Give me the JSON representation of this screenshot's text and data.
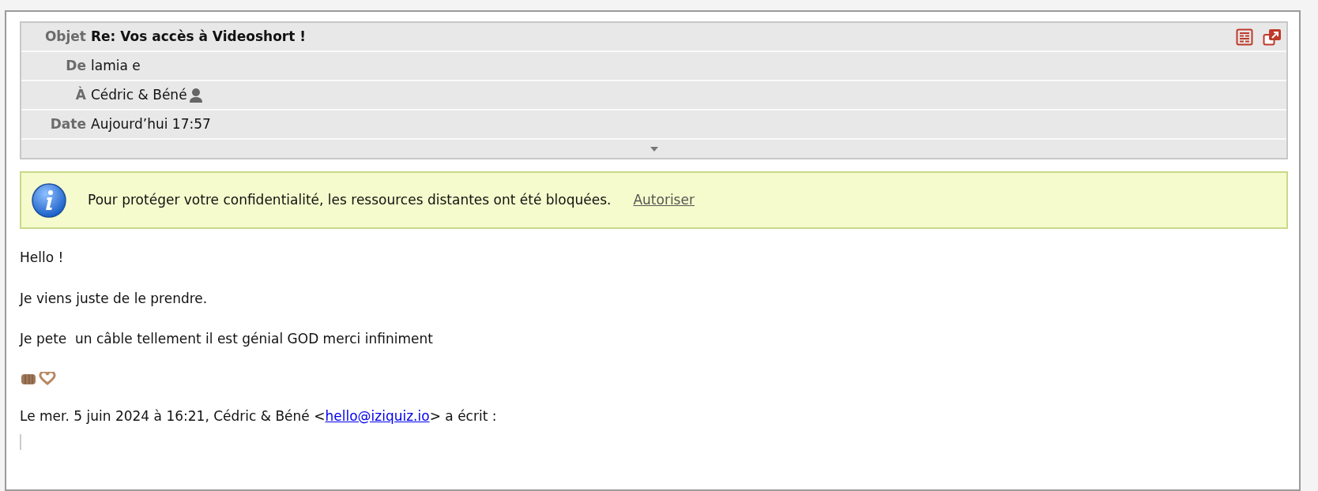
{
  "header": {
    "fields": [
      {
        "label": "Objet",
        "value": "Re: Vos accès à Videoshort !",
        "kind": "subject"
      },
      {
        "label": "De",
        "value": "lamia e",
        "kind": "plain"
      },
      {
        "label": "À",
        "value": "Cédric & Béné",
        "kind": "contact"
      },
      {
        "label": "Date",
        "value": "Aujourd’hui 17:57",
        "kind": "plain"
      }
    ],
    "expanded": false
  },
  "notice": {
    "text": "Pour protéger votre confidentialité, les ressources distantes ont été bloquées.",
    "action": "Autoriser"
  },
  "body": {
    "paragraphs": [
      {
        "kind": "text",
        "text": "Hello !"
      },
      {
        "kind": "text",
        "text": "Je viens juste de le prendre."
      },
      {
        "kind": "text",
        "text": "Je pete  un câble tellement il est génial GOD merci infiniment"
      },
      {
        "kind": "emoji"
      },
      {
        "kind": "quote_intro",
        "before": "Le mer. 5 juin 2024 à 16:21, Cédric & Béné <",
        "link": "hello@iziquiz.io",
        "after": "> a écrit :"
      }
    ]
  }
}
